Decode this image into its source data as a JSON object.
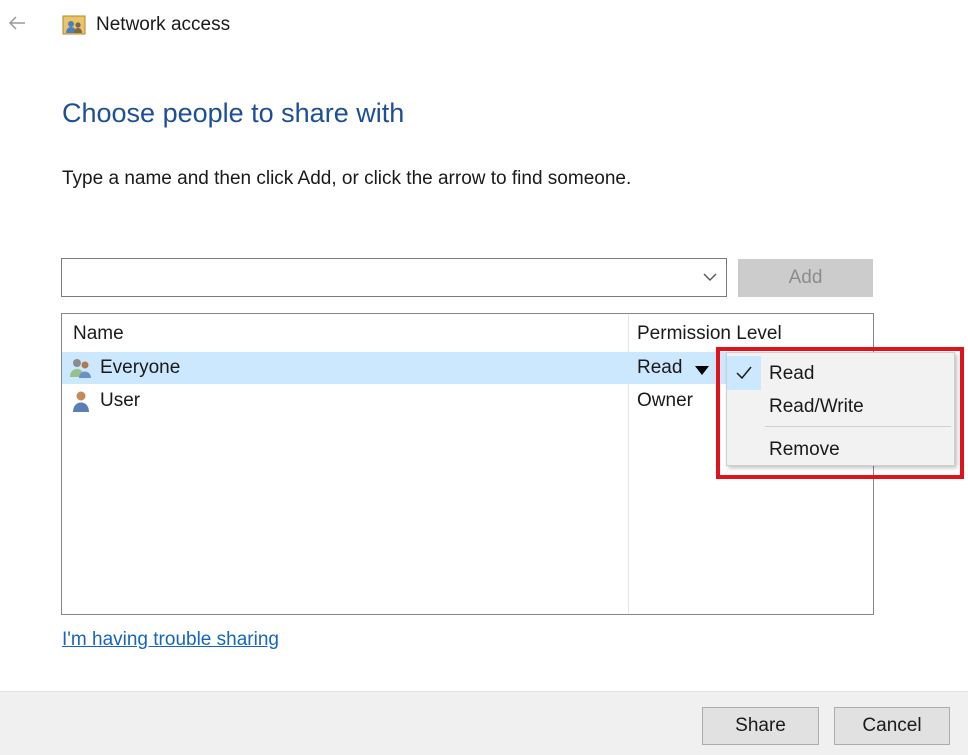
{
  "window": {
    "title": "Network access"
  },
  "page": {
    "heading": "Choose people to share with",
    "instructions": "Type a name and then click Add, or click the arrow to find someone."
  },
  "name_input": {
    "value": "",
    "placeholder": ""
  },
  "add_button": {
    "label": "Add",
    "enabled": false
  },
  "list": {
    "columns": [
      "Name",
      "Permission Level"
    ],
    "rows": [
      {
        "name": "Everyone",
        "permission": "Read",
        "selected": true,
        "icon": "group-users-icon"
      },
      {
        "name": "User",
        "permission": "Owner",
        "selected": false,
        "icon": "user-icon"
      }
    ]
  },
  "permission_menu": {
    "items": [
      {
        "label": "Read",
        "checked": true
      },
      {
        "label": "Read/Write",
        "checked": false
      },
      {
        "label": "Remove",
        "checked": false
      }
    ]
  },
  "trouble_link": "I'm having trouble sharing",
  "footer": {
    "share_label": "Share",
    "cancel_label": "Cancel"
  },
  "colors": {
    "heading": "#1e4e96",
    "selection": "#cce8ff",
    "highlight_border": "#e0121b",
    "link": "#1565c0"
  }
}
